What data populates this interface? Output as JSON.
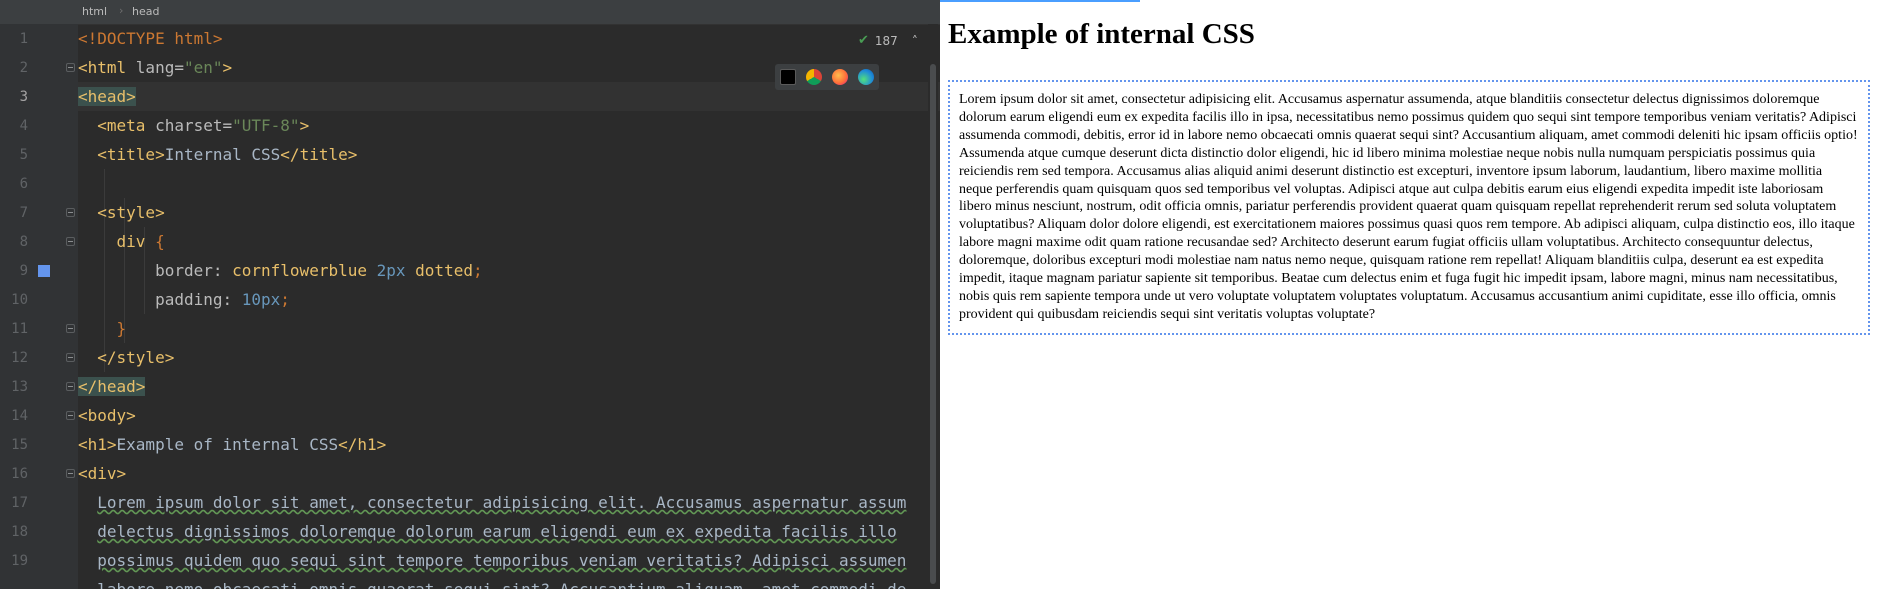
{
  "breadcrumb": [
    "html",
    "head"
  ],
  "inspection": {
    "count": "187"
  },
  "browser_icons": [
    "intellij-icon",
    "chrome-icon",
    "firefox-icon",
    "edge-icon"
  ],
  "code": {
    "line_numbers": [
      "1",
      "2",
      "3",
      "4",
      "5",
      "6",
      "7",
      "8",
      "9",
      "10",
      "11",
      "12",
      "13",
      "14",
      "15",
      "16",
      "17",
      "18",
      "19"
    ],
    "l1_doctype": "<!DOCTYPE html>",
    "l2_open": "<html ",
    "l2_attr": "lang=",
    "l2_val": "\"en\"",
    "l2_close": ">",
    "l3": "<head>",
    "l4_open": "<meta ",
    "l4_attr": "charset=",
    "l4_val": "\"UTF-8\"",
    "l4_close": ">",
    "l5_open": "<title>",
    "l5_text": "Internal CSS",
    "l5_close": "</title>",
    "l7": "<style>",
    "l8_sel": "div ",
    "l8_brace": "{",
    "l9_prop": "border",
    "l9_colon": ": ",
    "l9_val1": "cornflowerblue ",
    "l9_num": "2px",
    "l9_val2": " dotted",
    "l9_semi": ";",
    "l10_prop": "padding",
    "l10_colon": ": ",
    "l10_num": "10px",
    "l10_semi": ";",
    "l11": "}",
    "l12": "</style>",
    "l13": "</head>",
    "l14": "<body>",
    "l15_open": "<h1>",
    "l15_text": "Example of internal CSS",
    "l15_close": "</h1>",
    "l16": "<div>",
    "l17": "Lorem ipsum dolor sit amet, consectetur adipisicing elit. Accusamus aspernatur assum",
    "l18": "delectus dignissimos doloremque dolorum earum eligendi eum ex expedita facilis illo",
    "l19": "possimus quidem quo sequi sint tempore temporibus veniam veritatis? Adipisci assumen",
    "l20": "labore nemo obcaecati omnis quaerat sequi sint? Accusantium aliquam, amet commodi de"
  },
  "preview": {
    "heading": "Example of internal CSS",
    "paragraph": "Lorem ipsum dolor sit amet, consectetur adipisicing elit. Accusamus aspernatur assumenda, atque blanditiis consectetur delectus dignissimos doloremque dolorum earum eligendi eum ex expedita facilis illo in ipsa, necessitatibus nemo possimus quidem quo sequi sint tempore temporibus veniam veritatis? Adipisci assumenda commodi, debitis, error id in labore nemo obcaecati omnis quaerat sequi sint? Accusantium aliquam, amet commodi deleniti hic ipsam officiis optio! Assumenda atque cumque deserunt dicta distinctio dolor eligendi, hic id libero minima molestiae neque nobis nulla numquam perspiciatis possimus quia reiciendis rem sed tempora. Accusamus alias aliquid animi deserunt distinctio est excepturi, inventore ipsum laborum, laudantium, libero maxime mollitia neque perferendis quam quisquam quos sed temporibus vel voluptas. Adipisci atque aut culpa debitis earum eius eligendi expedita impedit iste laboriosam libero minus nesciunt, nostrum, odit officia omnis, pariatur perferendis provident quaerat quam quisquam repellat reprehenderit rerum sed soluta voluptatem voluptatibus? Aliquam dolor dolore eligendi, est exercitationem maiores possimus quasi quos rem tempore. Ab adipisci aliquam, culpa distinctio eos, illo itaque labore magni maxime odit quam ratione recusandae sed? Architecto deserunt earum fugiat officiis ullam voluptatibus. Architecto consequuntur delectus, doloremque, doloribus excepturi modi molestiae nam natus nemo neque, quisquam ratione rem repellat! Aliquam blanditiis culpa, deserunt ea est expedita impedit, itaque magnam pariatur sapiente sit temporibus. Beatae cum delectus enim et fuga fugit hic impedit ipsam, labore magni, minus nam necessitatibus, nobis quis rem sapiente tempora unde ut vero voluptate voluptatem voluptates voluptatum. Accusamus accusantium animi cupiditate, esse illo officia, omnis provident qui quibusdam reiciendis sequi sint veritatis voluptas voluptate?"
  },
  "colors": {
    "editor_bg": "#2b2b2b",
    "tag": "#e8bf6a",
    "string": "#6a8759",
    "number": "#6897bb",
    "swatch": "#6495ed",
    "border": "cornflowerblue"
  }
}
